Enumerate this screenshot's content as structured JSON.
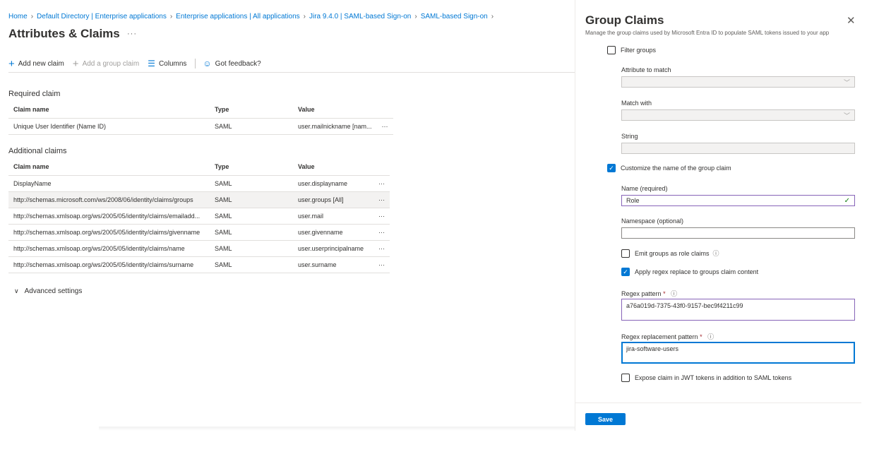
{
  "breadcrumb": [
    "Home",
    "Default Directory | Enterprise applications",
    "Enterprise applications | All applications",
    "Jira 9.4.0 | SAML-based Sign-on",
    "SAML-based Sign-on"
  ],
  "page": {
    "title": "Attributes & Claims",
    "more": "···"
  },
  "toolbar": {
    "add_new_claim": "Add new claim",
    "add_group_claim": "Add a group claim",
    "columns": "Columns",
    "feedback": "Got feedback?"
  },
  "required": {
    "title": "Required claim",
    "headers": [
      "Claim name",
      "Type",
      "Value"
    ],
    "rows": [
      {
        "name": "Unique User Identifier (Name ID)",
        "type": "SAML",
        "value": "user.mailnickname [nam..."
      }
    ]
  },
  "additional": {
    "title": "Additional claims",
    "headers": [
      "Claim name",
      "Type",
      "Value"
    ],
    "rows": [
      {
        "name": "DisplayName",
        "type": "SAML",
        "value": "user.displayname"
      },
      {
        "name": "http://schemas.microsoft.com/ws/2008/06/identity/claims/groups",
        "type": "SAML",
        "value": "user.groups [All]"
      },
      {
        "name": "http://schemas.xmlsoap.org/ws/2005/05/identity/claims/emailadd...",
        "type": "SAML",
        "value": "user.mail"
      },
      {
        "name": "http://schemas.xmlsoap.org/ws/2005/05/identity/claims/givenname",
        "type": "SAML",
        "value": "user.givenname"
      },
      {
        "name": "http://schemas.xmlsoap.org/ws/2005/05/identity/claims/name",
        "type": "SAML",
        "value": "user.userprincipalname"
      },
      {
        "name": "http://schemas.xmlsoap.org/ws/2005/05/identity/claims/surname",
        "type": "SAML",
        "value": "user.surname"
      }
    ],
    "more": "···"
  },
  "advanced_settings": "Advanced settings",
  "panel": {
    "title": "Group Claims",
    "subtitle": "Manage the group claims used by Microsoft Entra ID to populate SAML tokens issued to your app",
    "filter_groups": "Filter groups",
    "attribute_to_match": "Attribute to match",
    "match_with": "Match with",
    "string": "String",
    "customize_name": "Customize the name of the group claim",
    "name_label": "Name (required)",
    "name_value": "Role",
    "namespace_label": "Namespace (optional)",
    "namespace_value": "",
    "emit_role": "Emit groups as role claims",
    "apply_regex": "Apply regex replace to groups claim content",
    "regex_pattern_label": "Regex pattern",
    "regex_pattern_value": "a76a019d-7375-43f0-9157-bec9f4211c99",
    "regex_replacement_label": "Regex replacement pattern",
    "regex_replacement_value": "jira-software-users",
    "expose_jwt": "Expose claim in JWT tokens in addition to SAML tokens",
    "save": "Save",
    "checkbox_states": {
      "filter_groups": false,
      "customize_name": true,
      "emit_role": false,
      "apply_regex": true,
      "expose_jwt": false
    }
  },
  "colors": {
    "accent": "#0078d4",
    "purple_border": "#8764b8",
    "required_star": "#a4262c"
  }
}
